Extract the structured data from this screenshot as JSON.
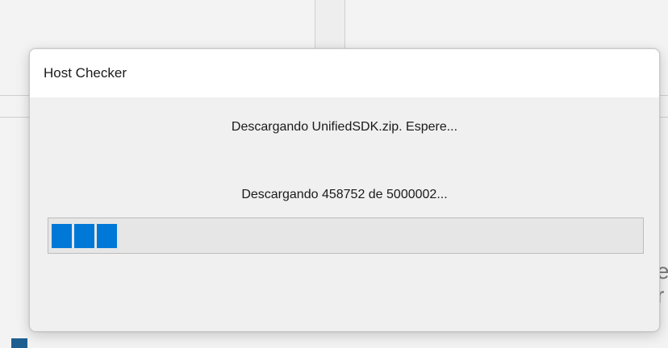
{
  "dialog": {
    "title": "Host Checker",
    "message": "Descargando UnifiedSDK.zip. Espere...",
    "status": "Descargando 458752 de 5000002..."
  },
  "progress": {
    "value": 458752,
    "max": 5000002,
    "color": "#0078d7"
  },
  "background": {
    "partial_text": "e\nr"
  }
}
